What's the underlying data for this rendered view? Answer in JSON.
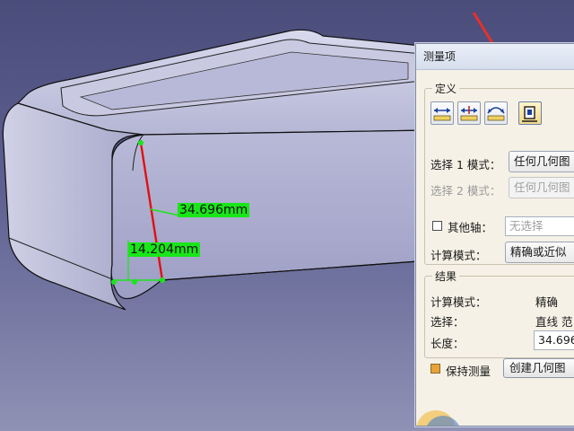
{
  "viewport": {
    "dimensions": [
      {
        "id": "length",
        "label": "34.696mm"
      },
      {
        "id": "distance",
        "label": "14.204mm"
      }
    ],
    "colors": {
      "measure_line": "#e01010",
      "tag": "#19e619",
      "annotation_arrow": "#e8302a"
    }
  },
  "dialog": {
    "title": "测量项",
    "definition": {
      "group_title": "定义",
      "tool_icons": [
        "measure-between-icon",
        "measure-between-chain-icon",
        "measure-between-fan-icon",
        "measure-item-icon"
      ],
      "active_tool": "measure-item-icon",
      "selection1_label": "选择 1 模式：",
      "selection1_value": "任何几何图",
      "selection2_label": "选择 2 模式：",
      "selection2_value": "任何几何图",
      "other_axis_label": "其他轴：",
      "other_axis_checked": false,
      "other_axis_value": "无选择",
      "calc_mode_label": "计算模式：",
      "calc_mode_value": "精确或近似"
    },
    "result": {
      "group_title": "结果",
      "calc_mode_label": "计算模式：",
      "calc_mode_value": "精确",
      "selection_label": "选择：",
      "selection_value": "直线 范",
      "length_label": "长度：",
      "length_value": "34.696"
    },
    "keep_measure_label": "保持测量",
    "keep_measure_checked": true,
    "create_geometry_label": "创建几何图"
  }
}
